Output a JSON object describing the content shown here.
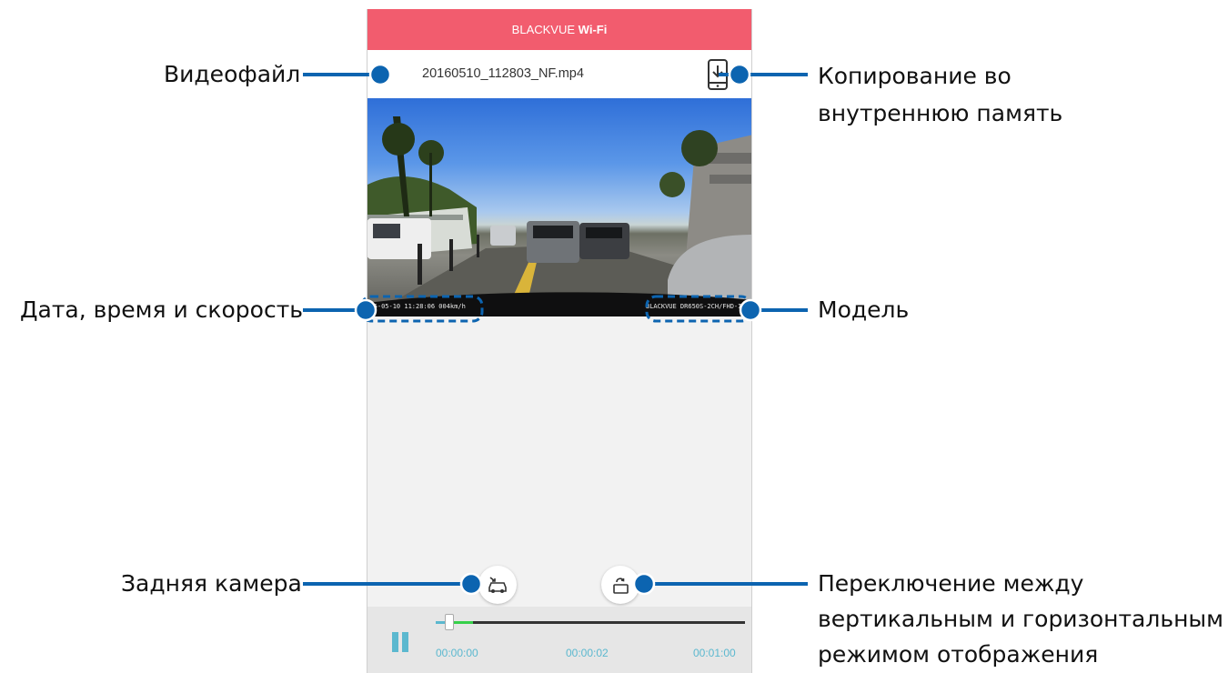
{
  "app": {
    "title_part1": "BLACKVUE",
    "title_part2": "Wi-Fi"
  },
  "file": {
    "name": "20160510_112803_NF.mp4"
  },
  "video_overlay": {
    "datetime_speed": "2016-05-10 11:28:06 004km/h",
    "model": "BLACKVUE DR650S-2CH/FHD-IR"
  },
  "player": {
    "time_start": "00:00:00",
    "time_current": "00:00:02",
    "time_end": "00:01:00",
    "progress_fraction": 0.033,
    "buffer_fraction": 0.12
  },
  "icons": {
    "back": "chevron-left-icon",
    "copy": "phone-download-icon",
    "rear_camera": "car-rear-icon",
    "rotate": "screen-rotate-icon",
    "pause": "pause-icon"
  },
  "colors": {
    "titlebar": "#f25c6e",
    "accent": "#5bb8cf",
    "buffer": "#36d04a",
    "callout": "#0c64b0"
  },
  "annotations": {
    "video_file": "Видеофайл",
    "copy_line1": "Копирование во",
    "copy_line2": "внутреннюю память",
    "date_time_speed": "Дата, время и скорость",
    "model": "Модель",
    "rear_camera": "Задняя камера",
    "switch_line1": "Переключение между",
    "switch_line2": "вертикальным и горизонтальным",
    "switch_line3": "режимом отображения"
  }
}
